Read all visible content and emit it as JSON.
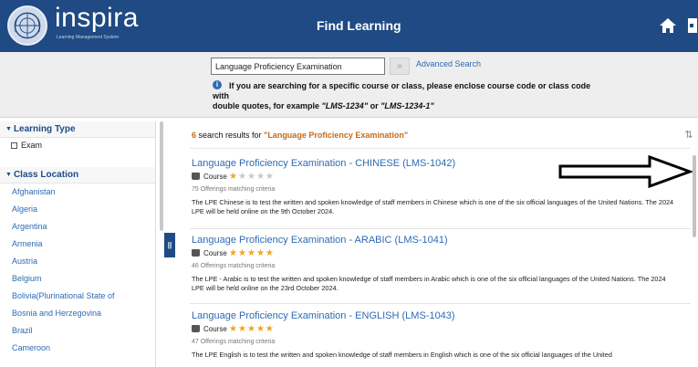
{
  "header": {
    "brand": "inspira",
    "brand_sub": "Learning Management System",
    "title": "Find Learning"
  },
  "search": {
    "value": "Language Proficiency Examination",
    "go_label": "»",
    "advanced_label": "Advanced Search",
    "hint_line1": "If you are searching for a specific course or class, please enclose course code or class code",
    "hint_line2": "with",
    "hint_line3_prefix": "double quotes, for example ",
    "hint_example1": "\"LMS-1234\"",
    "hint_or": " or ",
    "hint_example2": "\"LMS-1234-1\""
  },
  "facets": {
    "learning_type": {
      "title": "Learning Type",
      "options": [
        "Exam"
      ]
    },
    "class_location": {
      "title": "Class Location",
      "items": [
        "Afghanistan",
        "Algeria",
        "Argentina",
        "Armenia",
        "Austria",
        "Belgium",
        "Bolivia(Plurinational State of",
        "Bosnia and Herzegovina",
        "Brazil",
        "Cameroon"
      ]
    }
  },
  "results": {
    "count": "6",
    "summary_text": " search results for ",
    "query_quoted": "\"Language Proficiency Examination\"",
    "items": [
      {
        "title": "Language Proficiency Examination - CHINESE (LMS-1042)",
        "type": "Course",
        "rating": 1,
        "offerings": "75 Offerings matching criteria",
        "description": "The LPE Chinese is to test the written and spoken knowledge of staff members in Chinese which is one of the six official languages of the United Nations. The 2024 LPE will be held online on the 9th October 2024."
      },
      {
        "title": "Language Proficiency Examination - ARABIC (LMS-1041)",
        "type": "Course",
        "rating": 5,
        "offerings": "46 Offerings matching criteria",
        "description": "The LPE - Arabic is to test the written and spoken knowledge of staff members in Arabic which is one of the six official languages of the United Nations. The 2024 LPE will be held online on the 23rd October 2024."
      },
      {
        "title": "Language Proficiency Examination - ENGLISH (LMS-1043)",
        "type": "Course",
        "rating": 5,
        "offerings": "47 Offerings matching criteria",
        "description": "The LPE English is to test the written and spoken knowledge of staff members in English which is one of the six official languages of the United"
      }
    ]
  },
  "icons": {
    "home": "home-icon",
    "exit": "exit-icon",
    "sort": "sort-icon",
    "info": "info-icon",
    "collapse": "collapse-panel-icon",
    "arrow": "annotation-arrow"
  },
  "colors": {
    "header_bg": "#1f4a84",
    "link": "#2e6bb3",
    "query_highlight": "#c46a16",
    "star_on": "#f1a51f",
    "star_off": "#c8c8c8"
  }
}
